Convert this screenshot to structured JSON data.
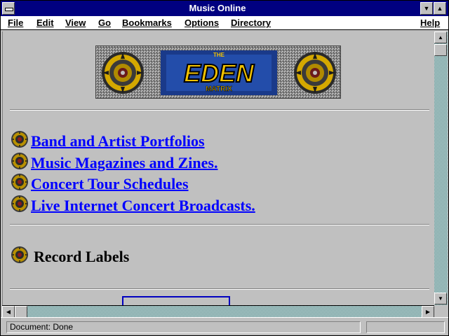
{
  "window": {
    "title": "Music Online"
  },
  "titlebar": {
    "minimize_glyph": "▼",
    "maximize_glyph": "▲"
  },
  "menubar": {
    "items": [
      {
        "label": "File"
      },
      {
        "label": "Edit"
      },
      {
        "label": "View"
      },
      {
        "label": "Go"
      },
      {
        "label": "Bookmarks"
      },
      {
        "label": "Options"
      },
      {
        "label": "Directory"
      },
      {
        "label": "Help"
      }
    ]
  },
  "banner": {
    "line_top": "THE",
    "line_main": "EDEN",
    "line_bottom": "MATRIX"
  },
  "links": [
    {
      "label": "Band and Artist Portfolios "
    },
    {
      "label": "Music Magazines and Zines. "
    },
    {
      "label": "Concert Tour Schedules "
    },
    {
      "label": "Live Internet Concert Broadcasts. "
    }
  ],
  "section": {
    "label": "Record Labels"
  },
  "scrollbars": {
    "up": "▲",
    "down": "▼",
    "left": "◀",
    "right": "▶"
  },
  "status": {
    "text": "Document: Done"
  },
  "colors": {
    "titlebar": "#000080",
    "link": "#0000ff",
    "window_bg": "#c0c0c0",
    "banner_gold": "#f2c200"
  },
  "icons": {
    "bullet": "gear-medallion-icon",
    "system_menu": "system-menu-icon"
  }
}
